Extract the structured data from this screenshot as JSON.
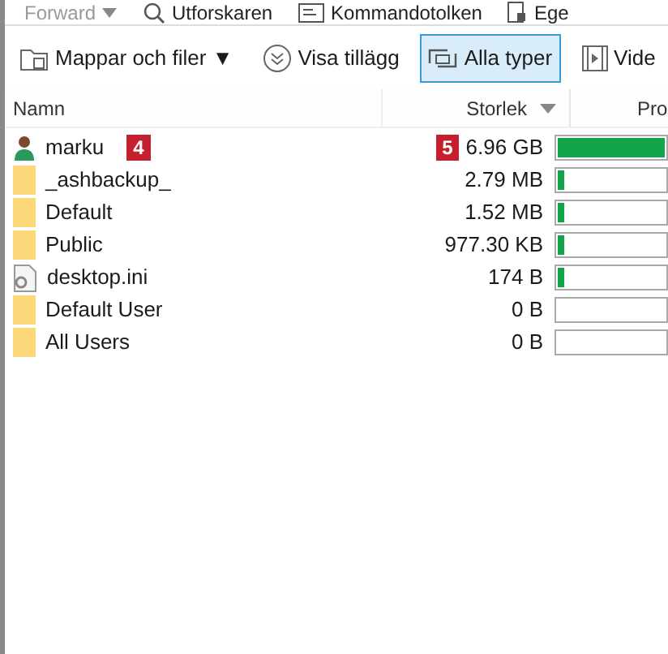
{
  "top_toolbar": [
    {
      "label": "Forward",
      "kind": "dropdown"
    },
    {
      "label": "Utforskaren",
      "kind": "search"
    },
    {
      "label": "Kommandotolken",
      "kind": "console"
    },
    {
      "label": "Ege",
      "kind": "doc"
    }
  ],
  "filter_toolbar": [
    {
      "label": "Mappar och filer ▼",
      "kind": "folders",
      "selected": false
    },
    {
      "label": "Visa tillägg",
      "kind": "chevrons",
      "selected": false
    },
    {
      "label": "Alla typer",
      "kind": "types",
      "selected": true
    },
    {
      "label": "Vide",
      "kind": "video",
      "selected": false
    }
  ],
  "table": {
    "columns": [
      "Namn",
      "Storlek",
      "Pro"
    ],
    "rows": [
      {
        "name": "marku",
        "kind": "user",
        "size": "6.96 GB",
        "level": 1.0,
        "name_badge": "4",
        "size_badge": "5"
      },
      {
        "name": "_ashbackup_",
        "kind": "folder",
        "size": "2.79 MB",
        "level": 0.02
      },
      {
        "name": "Default",
        "kind": "folder",
        "size": "1.52 MB",
        "level": 0.02
      },
      {
        "name": "Public",
        "kind": "folder",
        "size": "977.30 KB",
        "level": 0.02
      },
      {
        "name": "desktop.ini",
        "kind": "file",
        "size": "174 B",
        "level": 0.02
      },
      {
        "name": "Default User",
        "kind": "folder",
        "size": "0 B",
        "level": 0
      },
      {
        "name": "All Users",
        "kind": "folder",
        "size": "0 B",
        "level": 0
      }
    ]
  }
}
